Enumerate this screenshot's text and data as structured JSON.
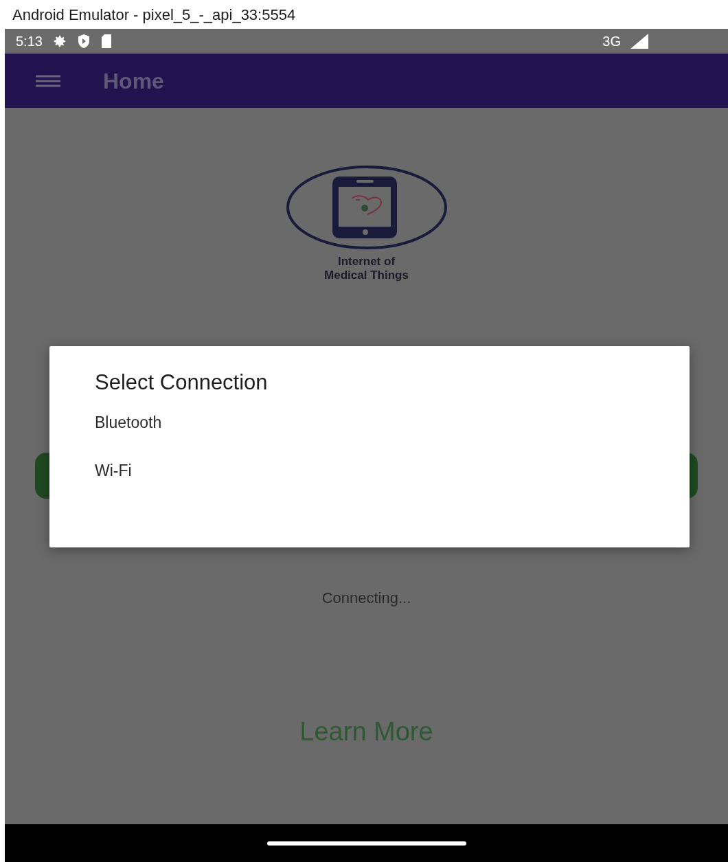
{
  "window": {
    "title": "Android Emulator - pixel_5_-_api_33:5554"
  },
  "status_bar": {
    "time": "5:13",
    "network": "3G"
  },
  "app_bar": {
    "title": "Home"
  },
  "logo": {
    "lines": [
      "Internet of",
      "Medical Things"
    ]
  },
  "dialog": {
    "title": "Select Connection",
    "options": [
      "Bluetooth",
      "Wi-Fi"
    ]
  },
  "status_text": "Connecting...",
  "link": "Learn More"
}
